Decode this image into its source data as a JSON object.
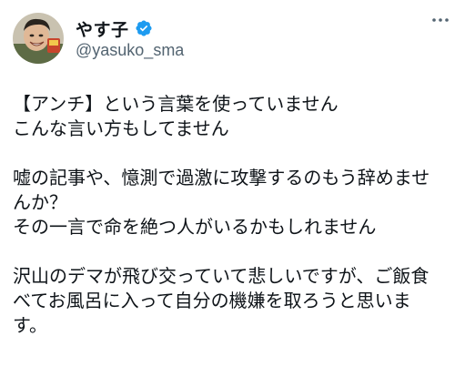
{
  "post": {
    "author": {
      "display_name": "やす子",
      "handle": "@yasuko_sma",
      "verified": true
    },
    "icons": {
      "verified": "verified-badge-icon",
      "more": "more-options-icon"
    },
    "colors": {
      "verified": "#1d9bf0",
      "text": "#0f1419",
      "secondary": "#536471"
    },
    "body_lines": [
      "【アンチ】という言葉を使っていません",
      "こんな言い方もしてません",
      "",
      "嘘の記事や、憶測で過激に攻撃するのもう辞めませ",
      "んか？",
      "その一言で命を絶つ人がいるかもしれません",
      "",
      "沢山のデマが飛び交っていて悲しいですが、ご飯食",
      "べてお風呂に入って自分の機嫌を取ろうと思いま",
      "す。"
    ]
  }
}
